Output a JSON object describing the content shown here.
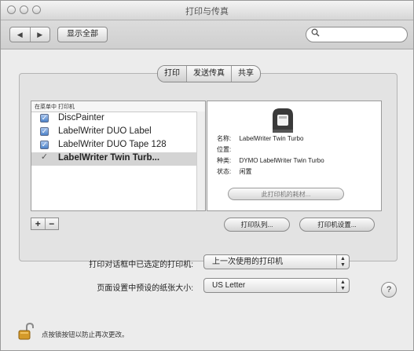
{
  "window": {
    "title": "打印与传真"
  },
  "toolbar": {
    "back_label": "◀",
    "forward_label": "▶",
    "show_all_label": "显示全部",
    "search_placeholder": ""
  },
  "tabs": [
    {
      "label": "打印"
    },
    {
      "label": "发送传真"
    },
    {
      "label": "共享"
    }
  ],
  "printer_list": {
    "col_default": "在菜单中",
    "col_printer": "打印机",
    "items": [
      {
        "name": "DiscPainter",
        "checked": true
      },
      {
        "name": "LabelWriter DUO Label",
        "checked": true
      },
      {
        "name": "LabelWriter DUO Tape 128",
        "checked": true
      },
      {
        "name": "LabelWriter Twin Turb...",
        "checked": false,
        "selected": true
      }
    ]
  },
  "details": {
    "name_label": "名称:",
    "name_value": "LabelWriter Twin Turbo",
    "location_label": "位置:",
    "location_value": "",
    "kind_label": "种类:",
    "kind_value": "DYMO LabelWriter Twin Turbo",
    "status_label": "状态:",
    "status_value": "闲置",
    "supplies_button": "此打印机的耗材..."
  },
  "controls": {
    "add_label": "+",
    "remove_label": "−",
    "queue_button": "打印队列...",
    "setup_button": "打印机设置..."
  },
  "settings": {
    "selected_printer_label": "打印对话框中已选定的打印机:",
    "selected_printer_value": "上一次使用的打印机",
    "paper_size_label": "页面设置中预设的纸张大小:",
    "paper_size_value": "US Letter"
  },
  "help_label": "?",
  "lock_text": "点按锁按钮以防止再次更改。"
}
